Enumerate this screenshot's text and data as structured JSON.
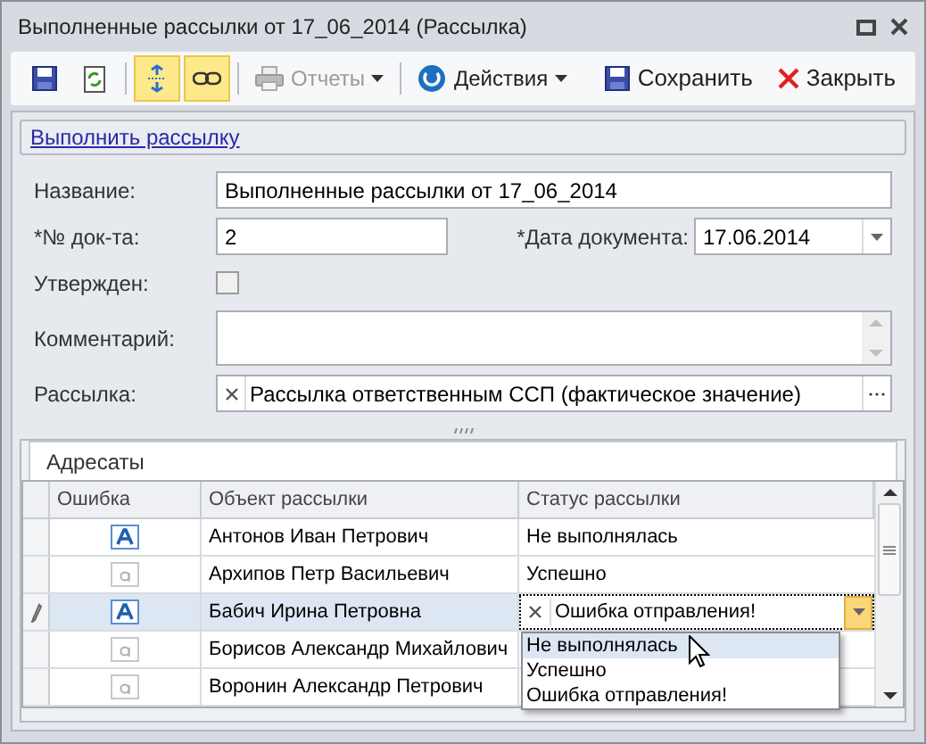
{
  "window": {
    "title": "Выполненные рассылки от 17_06_2014 (Рассылка)"
  },
  "toolbar": [
    {
      "kind": "save"
    },
    {
      "kind": "refresh"
    },
    {
      "kind": "expand",
      "on": true
    },
    {
      "kind": "link",
      "on": true
    },
    {
      "kind": "reports",
      "label": "Отчеты",
      "disabled": true
    },
    {
      "kind": "actions",
      "label": "Действия"
    },
    {
      "kind": "save-text",
      "label": "Сохранить"
    },
    {
      "kind": "close",
      "label": "Закрыть"
    }
  ],
  "action_link": "Выполнить рассылку",
  "form": {
    "name_label": "Название:",
    "name_value": "Выполненные рассылки от 17_06_2014",
    "doc_no_label": "*№ док-та:",
    "doc_no_value": "2",
    "date_label": "*Дата документа:",
    "date_value": "17.06.2014",
    "approved_label": "Утвержден:",
    "approved_checked": false,
    "comment_label": "Комментарий:",
    "mailing_label": "Рассылка:",
    "mailing_value": "Рассылка ответственным ССП (фактическое значение)"
  },
  "grid": {
    "title": "Адресаты",
    "columns": [
      "Ошибка",
      "Объект рассылки",
      "Статус рассылки"
    ],
    "rows": [
      {
        "error": true,
        "object": "Антонов Иван Петрович",
        "status": "Не выполнялась",
        "selected": false
      },
      {
        "error": false,
        "object": "Архипов Петр Васильевич",
        "status": "Успешно",
        "selected": false
      },
      {
        "error": true,
        "object": "Бабич Ирина Петровна",
        "status": "Ошибка отправления!",
        "selected": true
      },
      {
        "error": false,
        "object": "Борисов Александр Михайлович",
        "status": "",
        "selected": false
      },
      {
        "error": false,
        "object": "Воронин Александр Петрович",
        "status": "",
        "selected": false
      }
    ],
    "dropdown": [
      {
        "label": "Не выполнялась",
        "selected": true
      },
      {
        "label": "Успешно",
        "selected": false
      },
      {
        "label": "Ошибка отправления!",
        "selected": false
      }
    ]
  }
}
